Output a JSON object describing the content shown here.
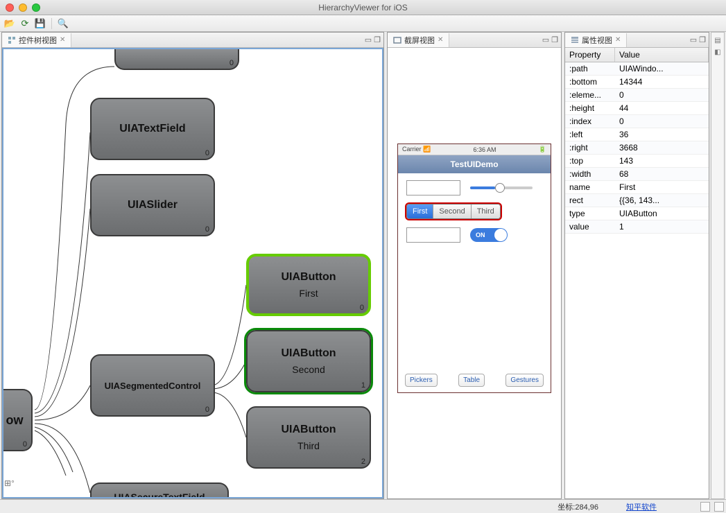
{
  "window": {
    "title": "HierarchyViewer for iOS"
  },
  "panels": {
    "left": {
      "tab": "控件树视图"
    },
    "mid": {
      "tab": "截屏视图"
    },
    "right": {
      "tab": "属性视图"
    }
  },
  "tree": {
    "root_label": "ow",
    "nodes": {
      "textfield": {
        "title": "UIATextField",
        "idx": "0"
      },
      "slider": {
        "title": "UIASlider",
        "idx": "0"
      },
      "segmented": {
        "title": "UIASegmentedControl",
        "idx": "0"
      },
      "btn_first": {
        "title": "UIAButton",
        "sub": "First",
        "idx": "0"
      },
      "btn_second": {
        "title": "UIAButton",
        "sub": "Second",
        "idx": "1"
      },
      "btn_third": {
        "title": "UIAButton",
        "sub": "Third",
        "idx": "2"
      },
      "secure": {
        "title": "UIASecureTextField"
      }
    }
  },
  "screenshot": {
    "carrier": "Carrier",
    "time": "6:36 AM",
    "nav_title": "TestUIDemo",
    "segments": [
      "First",
      "Second",
      "Third"
    ],
    "switch_label": "ON",
    "footer_buttons": [
      "Pickers",
      "Table",
      "Gestures"
    ]
  },
  "properties": {
    "headers": {
      "c1": "Property",
      "c2": "Value"
    },
    "rows": [
      {
        "k": ":path",
        "v": "UIAWindo..."
      },
      {
        "k": ":bottom",
        "v": "14344"
      },
      {
        "k": ":eleme...",
        "v": "0"
      },
      {
        "k": ":height",
        "v": "44"
      },
      {
        "k": ":index",
        "v": "0"
      },
      {
        "k": ":left",
        "v": "36"
      },
      {
        "k": ":right",
        "v": "3668"
      },
      {
        "k": ":top",
        "v": "143"
      },
      {
        "k": ":width",
        "v": "68"
      },
      {
        "k": "name",
        "v": "First"
      },
      {
        "k": "rect",
        "v": "{{36, 143..."
      },
      {
        "k": "type",
        "v": "UIAButton"
      },
      {
        "k": "value",
        "v": "1"
      }
    ]
  },
  "statusbar": {
    "coord": "坐标:284,96",
    "link": "知平软件"
  }
}
